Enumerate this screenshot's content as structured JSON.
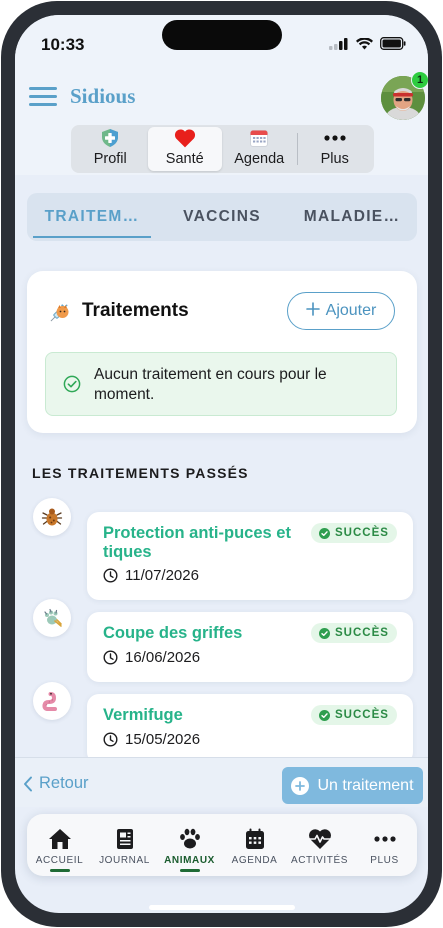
{
  "status_bar": {
    "time": "10:33"
  },
  "header": {
    "brand": "Sidious",
    "notification_count": "1"
  },
  "segments": [
    {
      "label": "Profil",
      "icon": "shield-medical-icon",
      "active": false
    },
    {
      "label": "Santé",
      "icon": "heart-icon",
      "active": true
    },
    {
      "label": "Agenda",
      "icon": "calendar-icon",
      "active": false
    },
    {
      "label": "Plus",
      "icon": "more-dots-icon",
      "active": false
    }
  ],
  "tabs": [
    {
      "label": "TRAITEM…",
      "active": true
    },
    {
      "label": "VACCINS",
      "active": false
    },
    {
      "label": "MALADIE…",
      "active": false
    }
  ],
  "treatments_card": {
    "title": "Traitements",
    "add_label": "Ajouter",
    "empty_message": "Aucun traitement en cours pour le moment."
  },
  "history": {
    "title": "LES TRAITEMENTS PASSÉS",
    "items": [
      {
        "name": "Protection anti-puces et tiques",
        "status": "SUCCÈS",
        "date": "11/07/2026",
        "icon": "flea-icon"
      },
      {
        "name": "Coupe des griffes",
        "status": "SUCCÈS",
        "date": "16/06/2026",
        "icon": "claw-trim-icon"
      },
      {
        "name": "Vermifuge",
        "status": "SUCCÈS",
        "date": "15/05/2026",
        "icon": "worm-icon"
      }
    ]
  },
  "footer": {
    "back_label": "Retour",
    "primary_label": "Un traitement"
  },
  "bottom_nav": [
    {
      "label": "ACCUEIL",
      "icon": "home-icon",
      "active": false
    },
    {
      "label": "JOURNAL",
      "icon": "journal-icon",
      "active": false
    },
    {
      "label": "ANIMAUX",
      "icon": "paw-icon",
      "active": true
    },
    {
      "label": "AGENDA",
      "icon": "calendar-icon",
      "active": false
    },
    {
      "label": "ACTIVITÉS",
      "icon": "heart-pulse-icon",
      "active": false
    },
    {
      "label": "PLUS",
      "icon": "more-dots-icon",
      "active": false
    }
  ],
  "colors": {
    "brand": "#5aa0c9",
    "success_text": "#27b38a",
    "badge_bg": "#e4f6e8",
    "primary_button": "#7fb9de",
    "background": "#e8eef8"
  }
}
